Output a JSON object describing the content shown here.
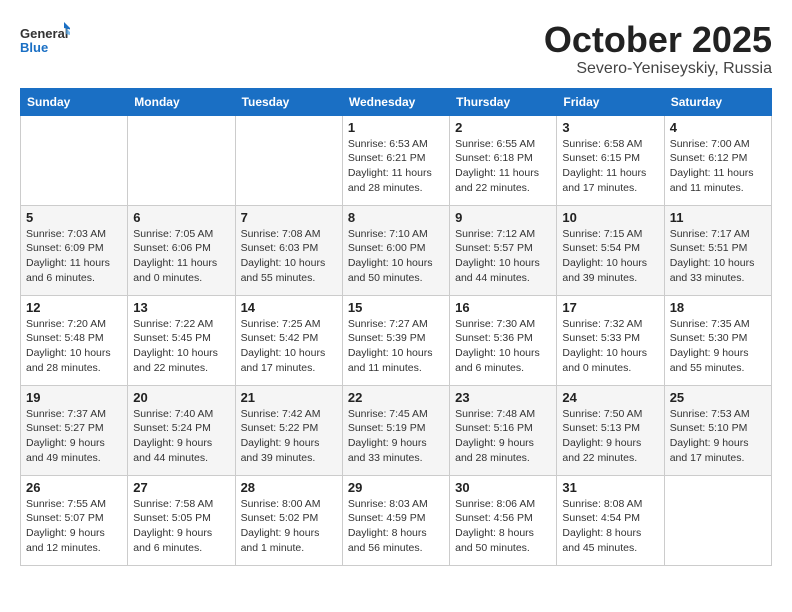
{
  "header": {
    "logo_general": "General",
    "logo_blue": "Blue",
    "month": "October 2025",
    "location": "Severo-Yeniseyskiy, Russia"
  },
  "weekdays": [
    "Sunday",
    "Monday",
    "Tuesday",
    "Wednesday",
    "Thursday",
    "Friday",
    "Saturday"
  ],
  "weeks": [
    [
      {
        "day": "",
        "info": ""
      },
      {
        "day": "",
        "info": ""
      },
      {
        "day": "",
        "info": ""
      },
      {
        "day": "1",
        "info": "Sunrise: 6:53 AM\nSunset: 6:21 PM\nDaylight: 11 hours\nand 28 minutes."
      },
      {
        "day": "2",
        "info": "Sunrise: 6:55 AM\nSunset: 6:18 PM\nDaylight: 11 hours\nand 22 minutes."
      },
      {
        "day": "3",
        "info": "Sunrise: 6:58 AM\nSunset: 6:15 PM\nDaylight: 11 hours\nand 17 minutes."
      },
      {
        "day": "4",
        "info": "Sunrise: 7:00 AM\nSunset: 6:12 PM\nDaylight: 11 hours\nand 11 minutes."
      }
    ],
    [
      {
        "day": "5",
        "info": "Sunrise: 7:03 AM\nSunset: 6:09 PM\nDaylight: 11 hours\nand 6 minutes."
      },
      {
        "day": "6",
        "info": "Sunrise: 7:05 AM\nSunset: 6:06 PM\nDaylight: 11 hours\nand 0 minutes."
      },
      {
        "day": "7",
        "info": "Sunrise: 7:08 AM\nSunset: 6:03 PM\nDaylight: 10 hours\nand 55 minutes."
      },
      {
        "day": "8",
        "info": "Sunrise: 7:10 AM\nSunset: 6:00 PM\nDaylight: 10 hours\nand 50 minutes."
      },
      {
        "day": "9",
        "info": "Sunrise: 7:12 AM\nSunset: 5:57 PM\nDaylight: 10 hours\nand 44 minutes."
      },
      {
        "day": "10",
        "info": "Sunrise: 7:15 AM\nSunset: 5:54 PM\nDaylight: 10 hours\nand 39 minutes."
      },
      {
        "day": "11",
        "info": "Sunrise: 7:17 AM\nSunset: 5:51 PM\nDaylight: 10 hours\nand 33 minutes."
      }
    ],
    [
      {
        "day": "12",
        "info": "Sunrise: 7:20 AM\nSunset: 5:48 PM\nDaylight: 10 hours\nand 28 minutes."
      },
      {
        "day": "13",
        "info": "Sunrise: 7:22 AM\nSunset: 5:45 PM\nDaylight: 10 hours\nand 22 minutes."
      },
      {
        "day": "14",
        "info": "Sunrise: 7:25 AM\nSunset: 5:42 PM\nDaylight: 10 hours\nand 17 minutes."
      },
      {
        "day": "15",
        "info": "Sunrise: 7:27 AM\nSunset: 5:39 PM\nDaylight: 10 hours\nand 11 minutes."
      },
      {
        "day": "16",
        "info": "Sunrise: 7:30 AM\nSunset: 5:36 PM\nDaylight: 10 hours\nand 6 minutes."
      },
      {
        "day": "17",
        "info": "Sunrise: 7:32 AM\nSunset: 5:33 PM\nDaylight: 10 hours\nand 0 minutes."
      },
      {
        "day": "18",
        "info": "Sunrise: 7:35 AM\nSunset: 5:30 PM\nDaylight: 9 hours\nand 55 minutes."
      }
    ],
    [
      {
        "day": "19",
        "info": "Sunrise: 7:37 AM\nSunset: 5:27 PM\nDaylight: 9 hours\nand 49 minutes."
      },
      {
        "day": "20",
        "info": "Sunrise: 7:40 AM\nSunset: 5:24 PM\nDaylight: 9 hours\nand 44 minutes."
      },
      {
        "day": "21",
        "info": "Sunrise: 7:42 AM\nSunset: 5:22 PM\nDaylight: 9 hours\nand 39 minutes."
      },
      {
        "day": "22",
        "info": "Sunrise: 7:45 AM\nSunset: 5:19 PM\nDaylight: 9 hours\nand 33 minutes."
      },
      {
        "day": "23",
        "info": "Sunrise: 7:48 AM\nSunset: 5:16 PM\nDaylight: 9 hours\nand 28 minutes."
      },
      {
        "day": "24",
        "info": "Sunrise: 7:50 AM\nSunset: 5:13 PM\nDaylight: 9 hours\nand 22 minutes."
      },
      {
        "day": "25",
        "info": "Sunrise: 7:53 AM\nSunset: 5:10 PM\nDaylight: 9 hours\nand 17 minutes."
      }
    ],
    [
      {
        "day": "26",
        "info": "Sunrise: 7:55 AM\nSunset: 5:07 PM\nDaylight: 9 hours\nand 12 minutes."
      },
      {
        "day": "27",
        "info": "Sunrise: 7:58 AM\nSunset: 5:05 PM\nDaylight: 9 hours\nand 6 minutes."
      },
      {
        "day": "28",
        "info": "Sunrise: 8:00 AM\nSunset: 5:02 PM\nDaylight: 9 hours\nand 1 minute."
      },
      {
        "day": "29",
        "info": "Sunrise: 8:03 AM\nSunset: 4:59 PM\nDaylight: 8 hours\nand 56 minutes."
      },
      {
        "day": "30",
        "info": "Sunrise: 8:06 AM\nSunset: 4:56 PM\nDaylight: 8 hours\nand 50 minutes."
      },
      {
        "day": "31",
        "info": "Sunrise: 8:08 AM\nSunset: 4:54 PM\nDaylight: 8 hours\nand 45 minutes."
      },
      {
        "day": "",
        "info": ""
      }
    ]
  ]
}
